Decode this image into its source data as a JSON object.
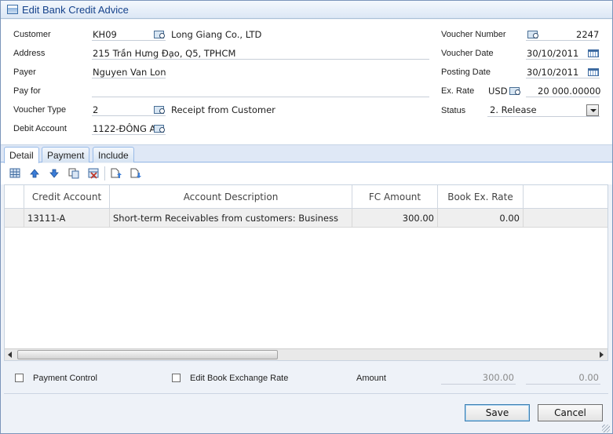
{
  "window": {
    "title": "Edit Bank Credit Advice"
  },
  "form": {
    "customer": {
      "label": "Customer",
      "code": "KH09",
      "name": "Long Giang Co., LTD"
    },
    "address": {
      "label": "Address",
      "value": "215 Trần Hưng Đạo, Q5, TPHCM"
    },
    "payer": {
      "label": "Payer",
      "value": "Nguyen Van Lon"
    },
    "pay_for": {
      "label": "Pay for",
      "value": ""
    },
    "voucher_type": {
      "label": "Voucher Type",
      "code": "2",
      "name": "Receipt from Customer"
    },
    "debit_account": {
      "label": "Debit Account",
      "value": "1122-ĐÔNG A"
    },
    "voucher_number": {
      "label": "Voucher Number",
      "value": "2247"
    },
    "voucher_date": {
      "label": "Voucher Date",
      "value": "30/10/2011"
    },
    "posting_date": {
      "label": "Posting Date",
      "value": "30/10/2011"
    },
    "ex_rate": {
      "label": "Ex. Rate",
      "currency": "USD",
      "value": "20 000.00000"
    },
    "status": {
      "label": "Status",
      "value": "2. Release"
    }
  },
  "tabs": [
    {
      "label": "Detail",
      "active": true
    },
    {
      "label": "Payment",
      "active": false
    },
    {
      "label": "Include",
      "active": false
    }
  ],
  "toolbar": {
    "icons": [
      "grid-new-row-icon",
      "move-up-icon",
      "move-down-icon",
      "copy-row-icon",
      "delete-row-icon",
      "insert-before-icon",
      "insert-after-icon"
    ]
  },
  "grid": {
    "columns": [
      "Credit Account",
      "Account Description",
      "FC Amount",
      "Book Ex. Rate"
    ],
    "rows": [
      {
        "credit_account": "13111-A",
        "description": "Short-term Receivables from customers: Business",
        "fc_amount": "300.00",
        "book_ex_rate": "0.00"
      }
    ]
  },
  "footer": {
    "payment_control": "Payment Control",
    "edit_book_rate": "Edit Book Exchange Rate",
    "amount_label": "Amount",
    "amount_fc": "300.00",
    "amount_book": "0.00",
    "save_label": "Save",
    "cancel_label": "Cancel"
  },
  "colors": {
    "title_text": "#15428b",
    "tab_border": "#99bbe8",
    "window_bg": "#eef2f8"
  }
}
